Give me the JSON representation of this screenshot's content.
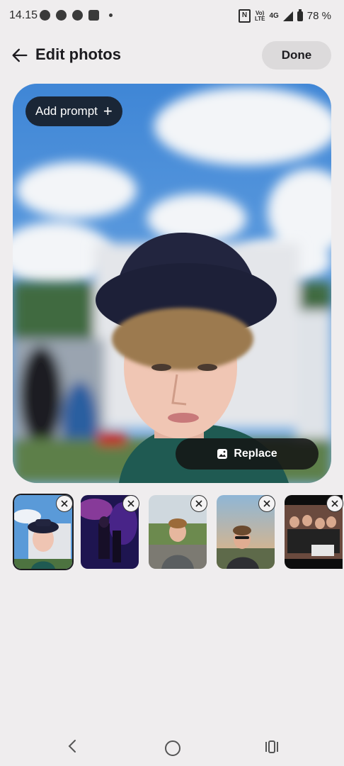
{
  "status_bar": {
    "time": "14.15",
    "battery": "78 %",
    "network": "4G",
    "volte": "Vo LTE"
  },
  "header": {
    "title": "Edit photos",
    "done_label": "Done"
  },
  "main_photo": {
    "add_prompt_label": "Add prompt",
    "replace_label": "Replace"
  },
  "thumbnails": [
    {
      "name": "thumb-1",
      "selected": true
    },
    {
      "name": "thumb-2",
      "selected": false
    },
    {
      "name": "thumb-3",
      "selected": false
    },
    {
      "name": "thumb-4",
      "selected": false
    },
    {
      "name": "thumb-5",
      "selected": false
    }
  ]
}
